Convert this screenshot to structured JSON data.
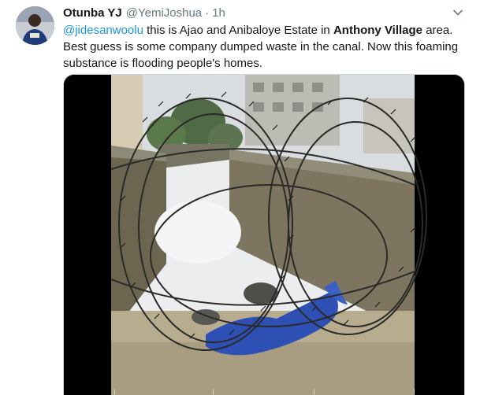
{
  "tweet": {
    "author_name": "Otunba YJ",
    "author_handle": "@YemiJoshua",
    "separator": "·",
    "timestamp": "1h",
    "text": {
      "mention": "@jidesanwoolu",
      "part1": " this is Ajao and Anibaloye Estate in ",
      "bold": "Anthony Village",
      "part2": " area. Best guess is some company dumped waste in the canal. Now this foaming substance is flooding people's homes."
    },
    "media": {
      "type": "video",
      "subject": "foam-filled canal behind razor wire fence"
    }
  },
  "icons": {
    "more": "chevron-down-icon",
    "avatar": "avatar"
  },
  "colors": {
    "link": "#1b95e0",
    "secondary_text": "#657786",
    "border": "#ccd6dd"
  }
}
